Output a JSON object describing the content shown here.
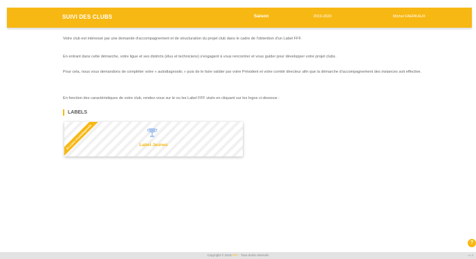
{
  "header": {
    "brand": "SUIVI DES CLUBS",
    "season_label": "Saison",
    "season_value": "2019-2020",
    "user_name": "Michel FAERKAUX"
  },
  "intro": {
    "p1": "Votre club est intéressé par une demande d'accompagnement et de structuration du projet club dans le cadre de l'obtention d'un Label FFF.",
    "p2": "En entrant dans cette démarche, votre ligue et ses districts (élus et techniciens) s'engagent à vous rencontrer et vous guider pour développer votre projet clubs.",
    "p3": "Pour cela, nous vous demandons de compléter votre « autodiagnostic » puis de le faire valider par votre Président et votre comité directeur afin que la démarche d'accompagnement des instances soit effective.",
    "p4": "En fonction des caractéristiques de votre club, rendez-vous sur le ou les Label FFF visés en cliquant sur les logos ci-dessous :"
  },
  "labels_section": {
    "title": "LABELS",
    "card": {
      "ribbon": "En cours d'autodiagnostic",
      "label": "Label Jeunes",
      "icon": "trophy-icon"
    }
  },
  "footer": {
    "copyright_prefix": "Copyright © 2019",
    "copyright_brand": "FFF",
    "copyright_suffix": "· Tous droits réservés",
    "version": "v1.0"
  },
  "fab": {
    "icon": "help-icon",
    "glyph": "?"
  },
  "colors": {
    "accent": "#f7b813",
    "footer": "#e3e3e3"
  }
}
